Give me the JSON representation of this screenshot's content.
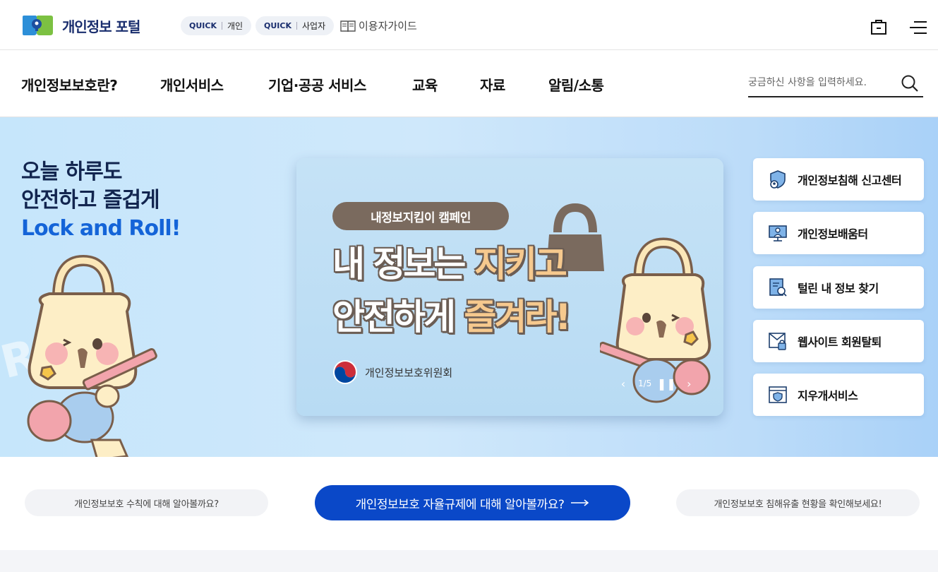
{
  "header": {
    "logo_text": "개인정보 포털",
    "quick_personal": {
      "prefix": "QUICK",
      "label": "개인"
    },
    "quick_business": {
      "prefix": "QUICK",
      "label": "사업자"
    },
    "guide_label": "이용자가이드",
    "icons": {
      "login": "lock-box-icon",
      "menu": "hamburger-menu-icon"
    }
  },
  "nav": {
    "items": [
      "개인정보보호란?",
      "개인서비스",
      "기업·공공 서비스",
      "교육",
      "자료",
      "알림/소통"
    ],
    "search_placeholder": "궁금하신 사항을 입력하세요."
  },
  "hero": {
    "title_line1": "오늘 하루도",
    "title_line2": "안전하고 즐겁게",
    "title_accent": "Lock and Roll!",
    "banner": {
      "campaign": "내정보지킴이 캠페인",
      "line1_a": "내 정보는 ",
      "line1_b": "지키고",
      "line2_a": "안전하게 ",
      "line2_b": "즐겨라!",
      "org": "개인정보보호위원회",
      "slide_counter": "1/5"
    },
    "services": [
      {
        "label": "개인정보침해 신고센터",
        "icon": "shield-user-icon"
      },
      {
        "label": "개인정보배움터",
        "icon": "monitor-teacher-icon"
      },
      {
        "label": "털린 내 정보 찾기",
        "icon": "document-search-icon"
      },
      {
        "label": "웹사이트 회원탈퇴",
        "icon": "envelope-lock-icon"
      },
      {
        "label": "지우개서비스",
        "icon": "browser-shield-icon"
      }
    ],
    "colors": {
      "accent": "#1464d8",
      "title": "#12254f",
      "pill": "#7a6a5e",
      "highlight": "#f6c98e"
    }
  },
  "info": {
    "left": "개인정보보호 수칙에 대해 알아볼까요?",
    "center": "개인정보보호 자율규제에 대해 알아볼까요?",
    "right": "개인정보보호 침해유출 현황을 확인해보세요!",
    "center_color": "#0a48c8"
  }
}
